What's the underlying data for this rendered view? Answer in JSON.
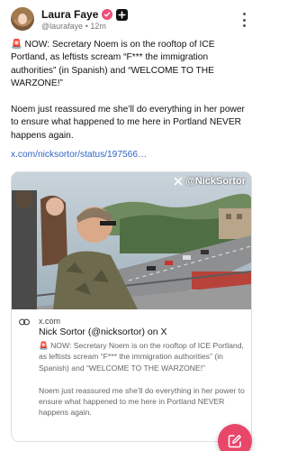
{
  "header": {
    "display_name": "Laura Faye",
    "handle": "@laurafaye",
    "separator": "•",
    "time": "12m",
    "icons": [
      "avatar",
      "verified-badge",
      "plus-badge",
      "more-vert-icon"
    ]
  },
  "post": {
    "paragraph1": "🚨 NOW: Secretary Noem is on the rooftop of ICE Portland, as leftists scream “F*** the immigration authorities” (in Spanish) and “WELCOME TO THE WARZONE!”",
    "paragraph2": "Noem just reassured me she’ll do everything in her power to ensure what happened to me here in Portland NEVER happens again.",
    "link": "x.com/nicksortor/status/197566…"
  },
  "card": {
    "watermark": "@NickSortor",
    "domain": "x.com",
    "title": "Nick Sortor (@nicksortor) on X",
    "desc1": "🚨 NOW: Secretary Noem is on the rooftop of ICE Portland, as leftists scream “F*** the immigration authorities” (in Spanish) and “WELCOME TO THE WARZONE!”",
    "desc2": "Noem just reassured me she’ll do everything in her power to ensure what happened to me here in Portland NEVER happens again."
  },
  "fab": {
    "icon": "compose-icon"
  },
  "colors": {
    "link": "#2f63c6",
    "verified": "#ec4f7a",
    "fab": "#e8476a",
    "muted": "#767676"
  }
}
